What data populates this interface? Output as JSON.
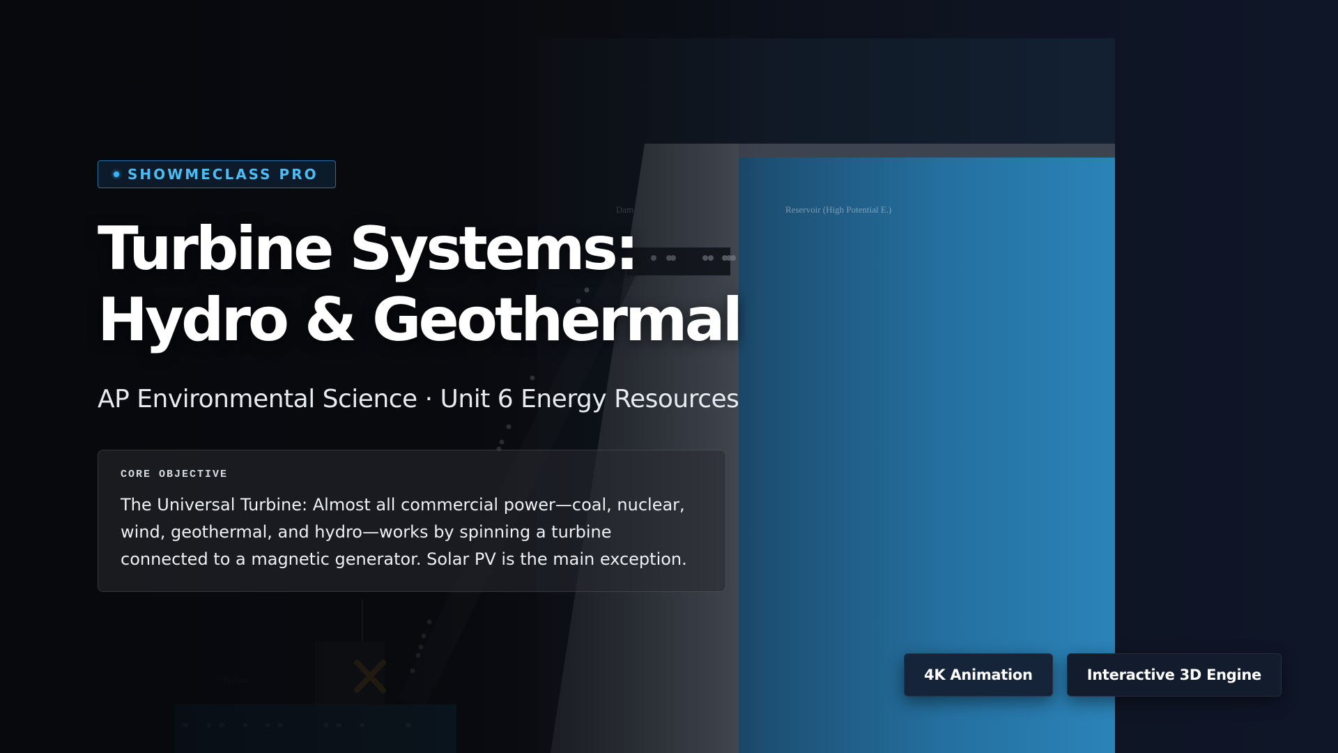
{
  "badge": {
    "label": "SHOWMECLASS PRO",
    "accent": "#3bb4f5"
  },
  "title": {
    "line1": "Turbine Systems:",
    "line2": "Hydro & Geothermal"
  },
  "subtitle": "AP Environmental Science · Unit 6 Energy Resources",
  "objective": {
    "label": "CORE OBJECTIVE",
    "text": "The Universal Turbine: Almost all commercial power—coal, nuclear, wind, geothermal, and hydro—works by spinning a turbine connected to a magnetic generator. Solar PV is the main exception."
  },
  "scene": {
    "labels": {
      "dam": "Dam",
      "reservoir": "Reservoir (High Potential E.)",
      "turbine": "Turbine"
    },
    "colors": {
      "water": "#2a7fb3",
      "dam": "#3a3f48",
      "turbine_blade": "#b5821e"
    }
  },
  "chips": [
    {
      "label": "4K Animation"
    },
    {
      "label": "Interactive 3D Engine"
    }
  ]
}
